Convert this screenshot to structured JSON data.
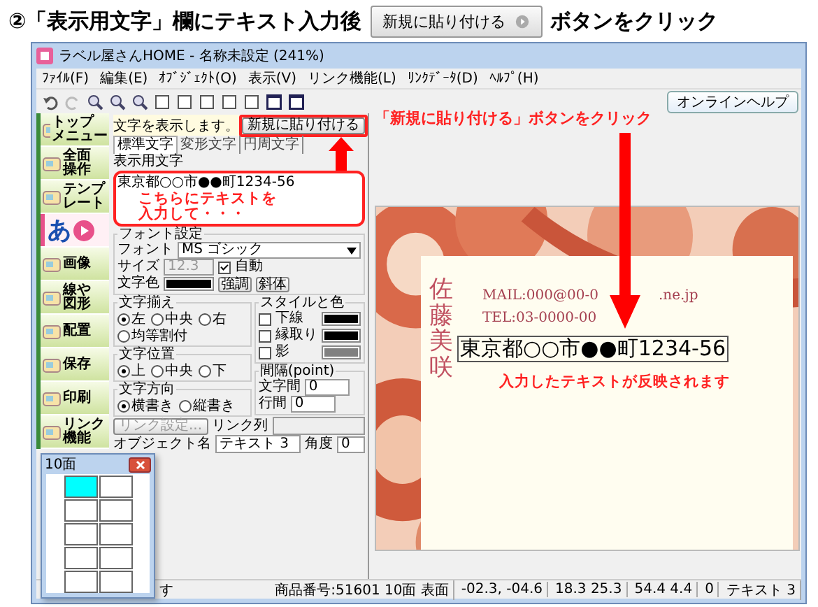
{
  "heading": {
    "number": "②",
    "before": "「表示用文字」欄にテキスト入力後",
    "button": "新規に貼り付ける",
    "after": "ボタンをクリック"
  },
  "window": {
    "title": "ラベル屋さんHOME - 名称未設定 (241%)",
    "help_button": "オンラインヘルプ"
  },
  "menu": [
    "ﾌｧｲﾙ(F)",
    "編集(E)",
    "ｵﾌﾞｼﾞｪｸﾄ(O)",
    "表示(V)",
    "リンク機能(L)",
    "ﾘﾝｸﾃﾞｰﾀ(D)",
    "ﾍﾙﾌﾟ(H)"
  ],
  "nav": [
    {
      "lines": [
        "トップ",
        "メニュー"
      ],
      "kind": "item",
      "selected": false
    },
    {
      "lines": [
        "全面",
        "操作"
      ],
      "kind": "item",
      "selected": false
    },
    {
      "lines": [
        "テンプ",
        "レート"
      ],
      "kind": "item",
      "selected": false
    },
    {
      "lines": [
        "あ"
      ],
      "kind": "text",
      "selected": true
    },
    {
      "lines": [
        "画像"
      ],
      "kind": "item",
      "selected": false
    },
    {
      "lines": [
        "線や",
        "図形"
      ],
      "kind": "item",
      "selected": false
    },
    {
      "lines": [
        "配置"
      ],
      "kind": "item",
      "selected": false
    },
    {
      "lines": [
        "保存"
      ],
      "kind": "item",
      "selected": false
    },
    {
      "lines": [
        "印刷"
      ],
      "kind": "item",
      "selected": false
    },
    {
      "lines": [
        "リンク",
        "機能"
      ],
      "kind": "item",
      "selected": false
    }
  ],
  "panel": {
    "info": "文字を表示します。",
    "paste_button": "新規に貼り付ける",
    "tabs": [
      {
        "label": "標準文字",
        "selected": true
      },
      {
        "label": "変形文字",
        "selected": false
      },
      {
        "label": "円周文字",
        "selected": false
      }
    ],
    "text_label": "表示用文字",
    "text_value": "東京都○○市●●町1234-56",
    "font_group": "フォント設定",
    "font_label": "フォント",
    "font_value": "MS ゴシック",
    "size_label": "サイズ",
    "size_value": "12.3",
    "auto": {
      "label": "自動",
      "checked": true
    },
    "color_label": "文字色",
    "bold_button": "強調",
    "italic_button": "斜体",
    "align_group": "文字揃え",
    "align": [
      {
        "label": "左",
        "selected": true
      },
      {
        "label": "中央",
        "selected": false
      },
      {
        "label": "右",
        "selected": false
      },
      {
        "label": "均等割付",
        "selected": false
      }
    ],
    "style_group": "スタイルと色",
    "styles": [
      {
        "label": "下線",
        "checked": false,
        "color": "#000000"
      },
      {
        "label": "縁取り",
        "checked": false,
        "color": "#000000"
      },
      {
        "label": "影",
        "checked": false,
        "color": "#808080"
      }
    ],
    "position_group": "文字位置",
    "position": [
      {
        "label": "上",
        "selected": true
      },
      {
        "label": "中央",
        "selected": false
      },
      {
        "label": "下",
        "selected": false
      }
    ],
    "direction_group": "文字方向",
    "direction": [
      {
        "label": "横書き",
        "selected": true
      },
      {
        "label": "縦書き",
        "selected": false
      }
    ],
    "spacing_group": "間隔(point)",
    "char_spacing_label": "文字間",
    "char_spacing": "0",
    "line_spacing_label": "行間",
    "line_spacing": "0",
    "link_button": "リンク設定...",
    "link_label": "リンク列",
    "object_label": "オブジェクト名",
    "object_value": "テキスト 3",
    "angle_label": "角度",
    "angle_value": "0"
  },
  "card": {
    "name": "佐藤美咲",
    "mail_left": "MAIL:000@00-0",
    "mail_right": ".ne.jp",
    "tel": "TEL:03-0000-00",
    "address": "東京都○○市●●町1234-56"
  },
  "notes": {
    "input": [
      "こちらにテキストを",
      "入力して・・・"
    ],
    "click": "「新規に貼り付ける」ボタンをクリック",
    "result": "入力したテキストが反映されます"
  },
  "sheet": {
    "title": "10面",
    "cells": [
      {
        "selected": true
      },
      {
        "selected": false
      },
      {
        "selected": false
      },
      {
        "selected": false
      },
      {
        "selected": false
      },
      {
        "selected": false
      },
      {
        "selected": false
      },
      {
        "selected": false
      },
      {
        "selected": false
      },
      {
        "selected": false
      }
    ]
  },
  "status": [
    "す",
    "商品番号:51601 10面 表面",
    "-02.3, -04.6",
    "18.3  25.3",
    "54.4  4.4",
    "0",
    "テキスト 3"
  ]
}
